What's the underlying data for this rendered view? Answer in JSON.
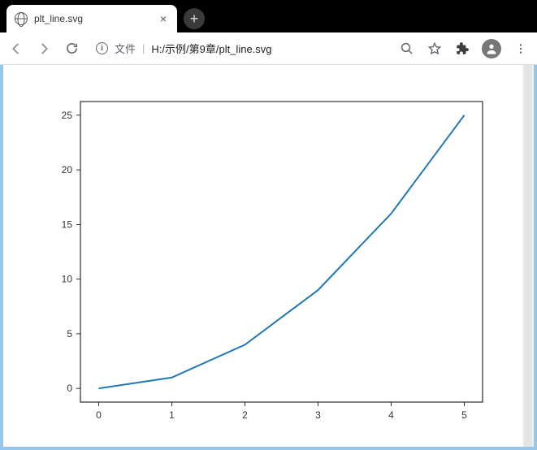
{
  "browser": {
    "tab_title": "plt_line.svg",
    "url_prefix": "文件",
    "url_path": "H:/示例/第9章/plt_line.svg"
  },
  "chart_data": {
    "type": "line",
    "x": [
      0,
      1,
      2,
      3,
      4,
      5
    ],
    "y": [
      0,
      1,
      4,
      9,
      16,
      25
    ],
    "title": "",
    "xlabel": "",
    "ylabel": "",
    "xlim": [
      -0.25,
      5.25
    ],
    "ylim": [
      -1.25,
      26.25
    ],
    "xticks": [
      0,
      1,
      2,
      3,
      4,
      5
    ],
    "yticks": [
      0,
      5,
      10,
      15,
      20,
      25
    ],
    "line_color": "#1f77b4"
  }
}
